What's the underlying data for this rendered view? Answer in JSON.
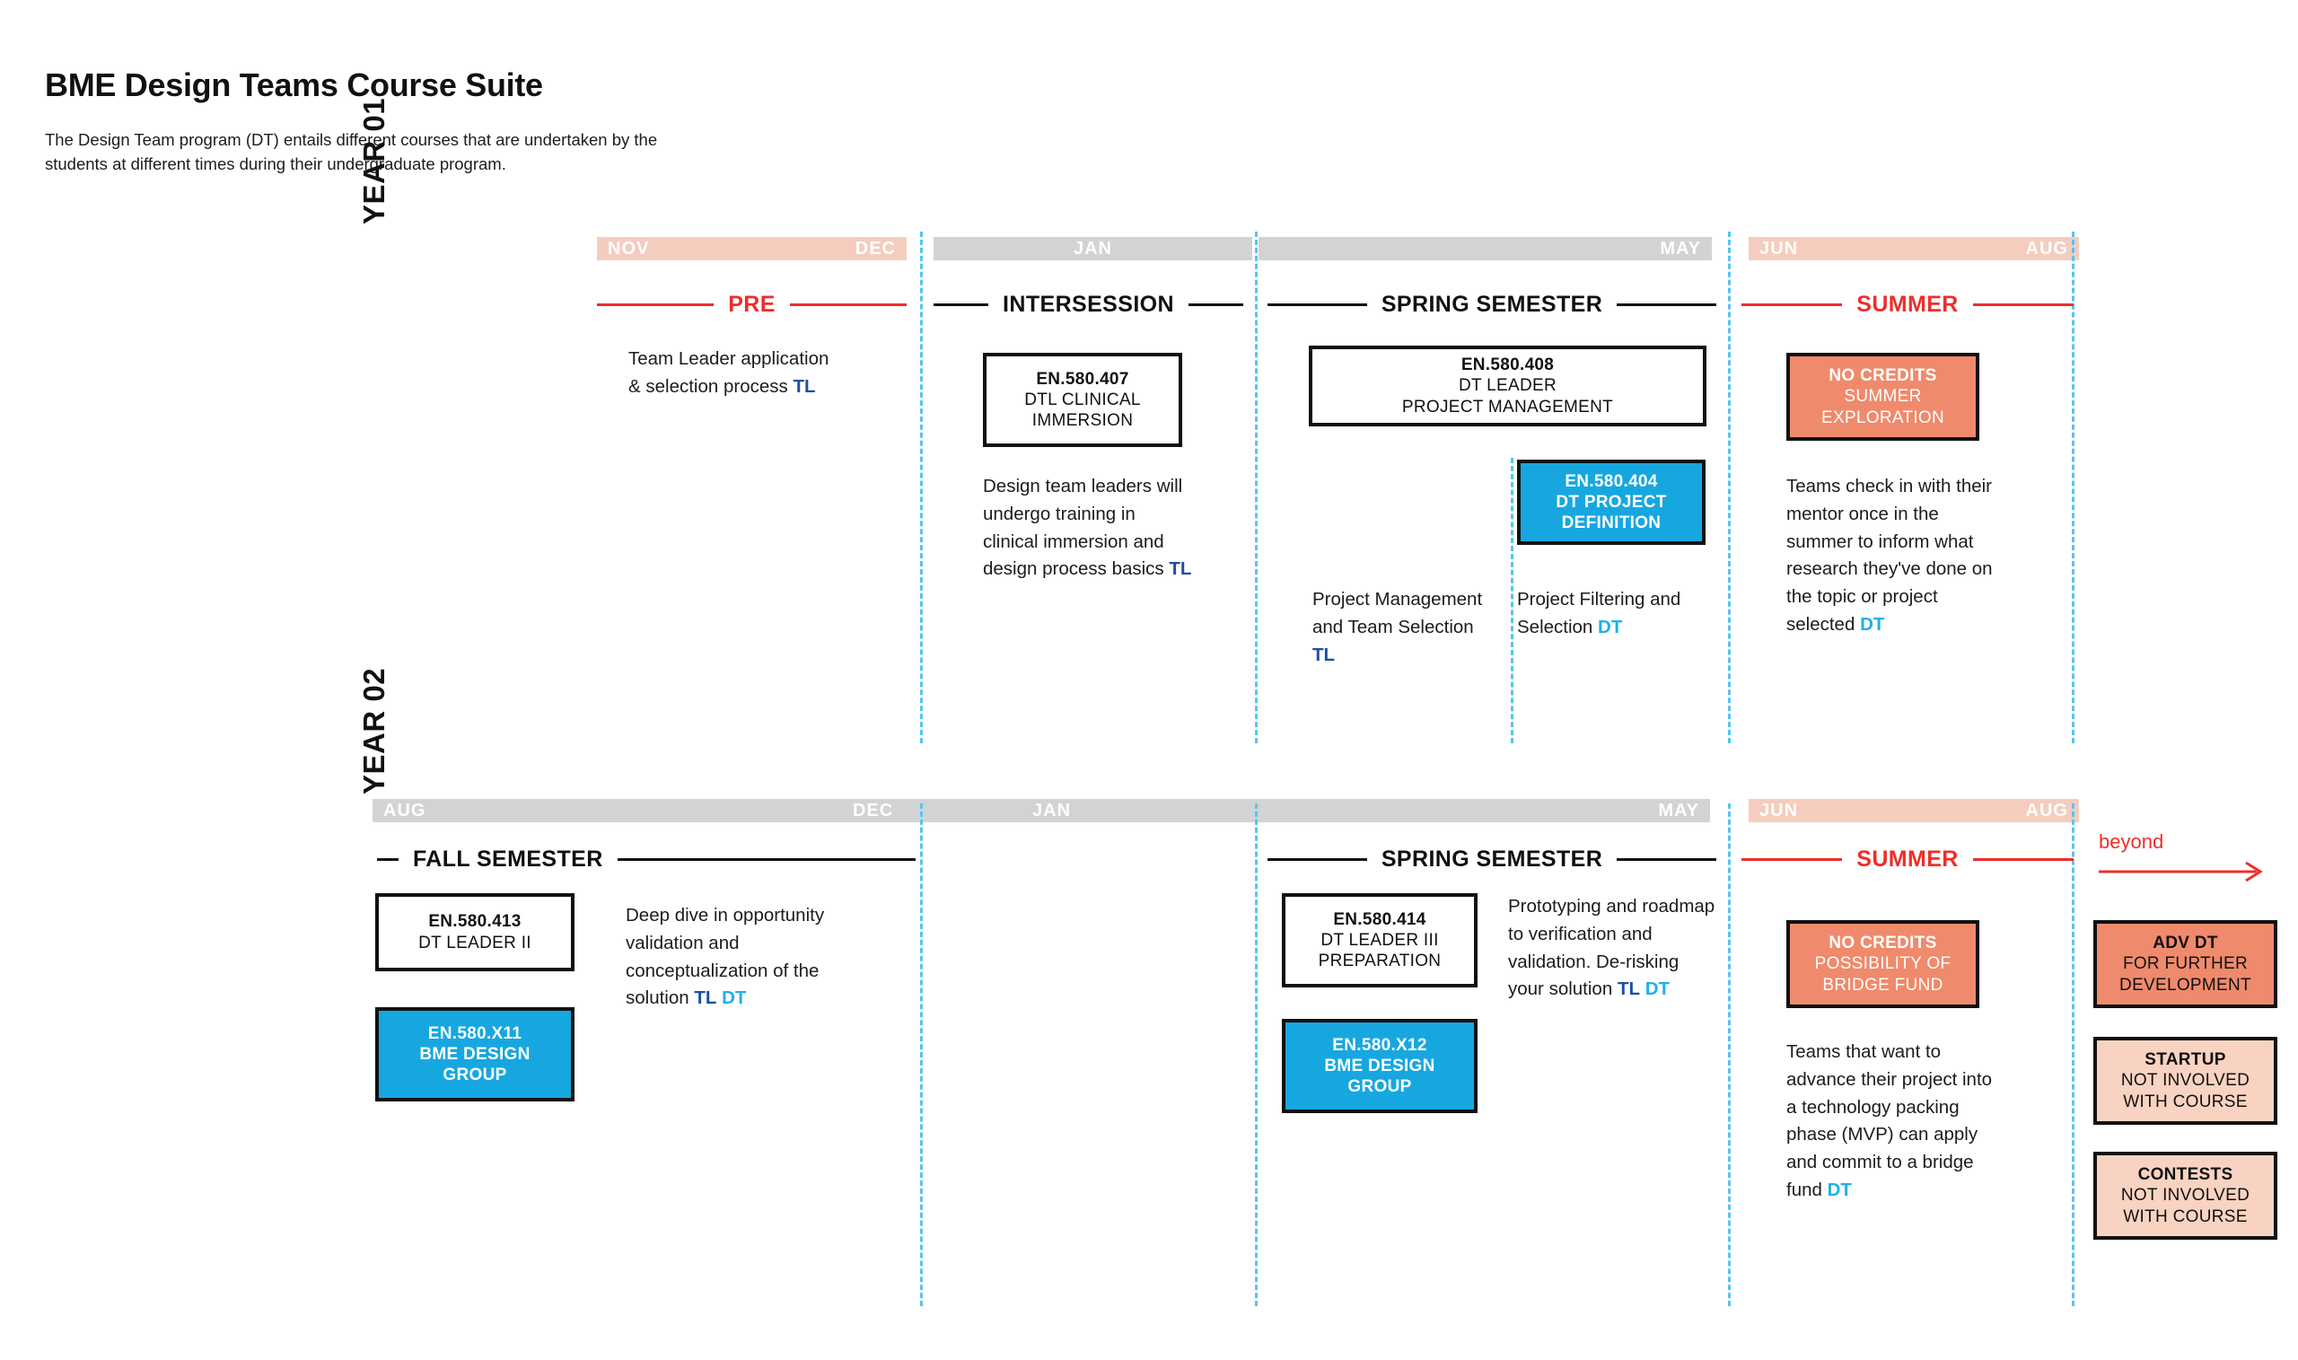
{
  "header": {
    "title": "BME Design Teams Course Suite",
    "subtitle": "The Design Team program (DT) entails different courses that are undertaken by the students at different times during their undergraduate program."
  },
  "legend": {
    "tl": "TL",
    "dt": "DT"
  },
  "colors": {
    "red": "#ee2e2b",
    "cyan": "#17a7e0",
    "salmon": "#f08a6c",
    "peach": "#f9d3c2",
    "gray": "#d2d3d5",
    "peach_bar": "#f4cdbe",
    "dash": "#57c4f0",
    "tl_blue": "#1c4fa1",
    "dt_blue": "#1fb0ea",
    "black": "#111111"
  },
  "year1": {
    "label": "YEAR 01",
    "months": [
      {
        "style": "peach",
        "left": "NOV",
        "right": "DEC"
      },
      {
        "style": "gray",
        "mid": "JAN"
      },
      {
        "style": "gray",
        "right": "MAY"
      },
      {
        "style": "peach",
        "left": "JUN",
        "right": "AUG"
      }
    ],
    "phases": [
      {
        "name": "PRE",
        "color": "red"
      },
      {
        "name": "INTERSESSION",
        "color": "black"
      },
      {
        "name": "SPRING SEMESTER",
        "color": "black"
      },
      {
        "name": "SUMMER",
        "color": "red"
      }
    ],
    "pre": {
      "desc_before": "Team Leader application & selection process ",
      "desc_tag": "TL"
    },
    "intersession": {
      "box": {
        "code": "EN.580.407",
        "line1": "DTL CLINICAL",
        "line2": "IMMERSION",
        "style": "white"
      },
      "desc_before": "Design team leaders will undergo training in clinical immersion and design process basics ",
      "desc_tag": "TL"
    },
    "spring": {
      "box_main": {
        "code": "EN.580.408",
        "line1": "DT LEADER",
        "line2": "PROJECT MANAGEMENT",
        "style": "white"
      },
      "box_sub": {
        "code": "EN.580.404",
        "line1": "DT PROJECT",
        "line2": "DEFINITION",
        "style": "cyan"
      },
      "desc_left_before": "Project Management and Team Selection ",
      "desc_left_tag": "TL",
      "desc_right_before": "Project Filtering and Selection ",
      "desc_right_tag": "DT"
    },
    "summer": {
      "box": {
        "code": "NO CREDITS",
        "line1": "SUMMER",
        "line2": "EXPLORATION",
        "style": "salmon"
      },
      "desc_before": "Teams check in with their mentor once in the summer to inform what research they've done on the topic or project selected ",
      "desc_tag": "DT"
    }
  },
  "year2": {
    "label": "YEAR 02",
    "months": [
      {
        "style": "gray",
        "left": "AUG",
        "mid2": "DEC",
        "mid3": "JAN",
        "right": "MAY"
      }
    ],
    "month_labels": {
      "aug": "AUG",
      "dec": "DEC",
      "jan": "JAN",
      "may": "MAY"
    },
    "summer_months": {
      "left": "JUN",
      "right": "AUG"
    },
    "phases": [
      {
        "name": "FALL SEMESTER",
        "color": "black"
      },
      {
        "name": "SPRING SEMESTER",
        "color": "black"
      },
      {
        "name": "SUMMER",
        "color": "red"
      }
    ],
    "fall": {
      "box_main": {
        "code": "EN.580.413",
        "line1": "DT LEADER II",
        "style": "white"
      },
      "box_sub": {
        "code": "EN.580.X11",
        "line1": "BME DESIGN",
        "line2": "GROUP",
        "style": "cyan"
      },
      "desc_before": "Deep dive in opportunity validation and conceptualization of the solution ",
      "desc_tag1": "TL",
      "desc_tag2": "DT"
    },
    "spring": {
      "box_main": {
        "code": "EN.580.414",
        "line1": "DT LEADER III",
        "line2": "PREPARATION",
        "style": "white"
      },
      "box_sub": {
        "code": "EN.580.X12",
        "line1": "BME DESIGN",
        "line2": "GROUP",
        "style": "cyan"
      },
      "desc_before": "Prototyping and roadmap to verification and validation. De-risking your solution ",
      "desc_tag1": "TL",
      "desc_tag2": "DT"
    },
    "summer": {
      "box": {
        "code": "NO CREDITS",
        "line1": "POSSIBILITY OF",
        "line2": "BRIDGE FUND",
        "style": "salmon"
      },
      "desc_before": "Teams that want to advance their project into a technology packing phase (MVP) can apply and commit to a bridge fund ",
      "desc_tag": "DT"
    },
    "beyond": {
      "label": "beyond",
      "boxes": [
        {
          "code": "ADV DT",
          "line1": "FOR FURTHER",
          "line2": "DEVELOPMENT",
          "style": "salmon"
        },
        {
          "code": "STARTUP",
          "line1": "NOT INVOLVED",
          "line2": "WITH COURSE",
          "style": "peach"
        },
        {
          "code": "CONTESTS",
          "line1": "NOT INVOLVED",
          "line2": "WITH COURSE",
          "style": "peach"
        }
      ]
    }
  }
}
